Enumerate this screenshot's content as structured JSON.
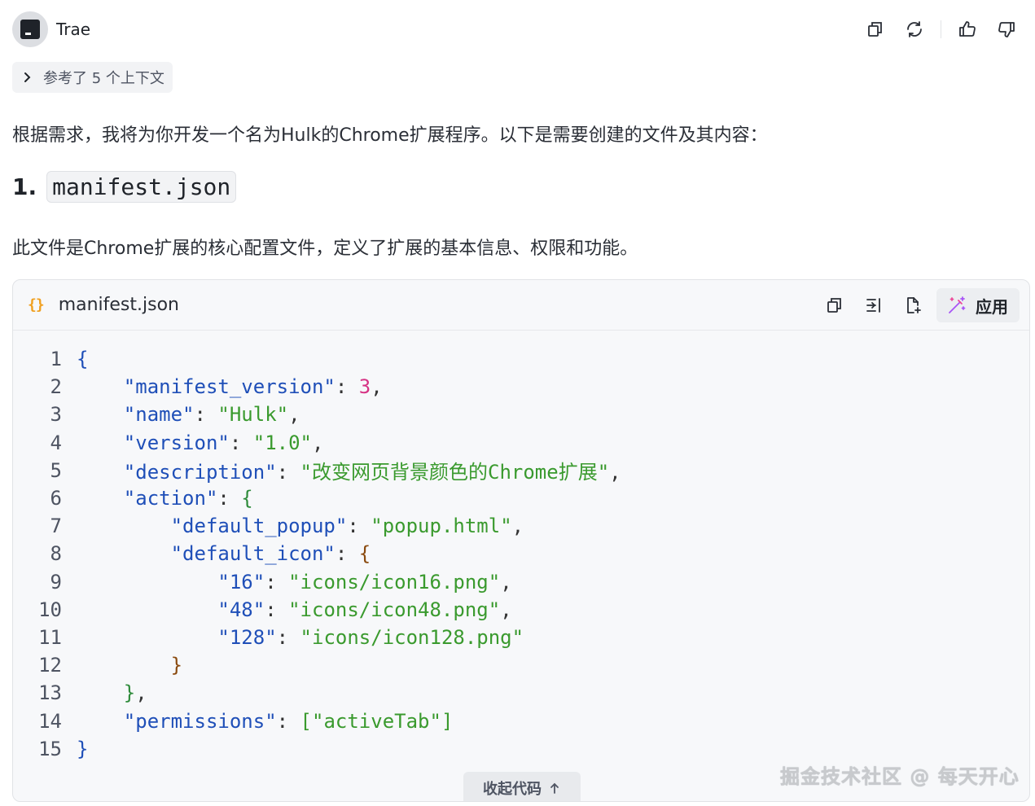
{
  "header": {
    "brand": "Trae",
    "actions": [
      "copy-icon",
      "refresh-icon",
      "thumb-up-icon",
      "thumb-down-icon"
    ]
  },
  "context": {
    "label": "参考了 5 个上下文"
  },
  "intro": "根据需求，我将为你开发一个名为Hulk的Chrome扩展程序。以下是需要创建的文件及其内容：",
  "section": {
    "number": "1.",
    "filename": "manifest.json"
  },
  "description": "此文件是Chrome扩展的核心配置文件，定义了扩展的基本信息、权限和功能。",
  "code_block": {
    "icon": "{}",
    "filename": "manifest.json",
    "apply_label": "应用",
    "collapse_label": "收起代码",
    "lines": [
      {
        "num": "1",
        "html": "<span class='b1'>{</span>"
      },
      {
        "num": "2",
        "html": "    <span class='k'>\"manifest_version\"</span><span class='p'>: </span><span class='n'>3</span><span class='p'>,</span>"
      },
      {
        "num": "3",
        "html": "    <span class='k'>\"name\"</span><span class='p'>: </span><span class='s'>\"Hulk\"</span><span class='p'>,</span>"
      },
      {
        "num": "4",
        "html": "    <span class='k'>\"version\"</span><span class='p'>: </span><span class='s'>\"1.0\"</span><span class='p'>,</span>"
      },
      {
        "num": "5",
        "html": "    <span class='k'>\"description\"</span><span class='p'>: </span><span class='s'>\"改变网页背景颜色的Chrome扩展\"</span><span class='p'>,</span>"
      },
      {
        "num": "6",
        "html": "    <span class='k'>\"action\"</span><span class='p'>: </span><span class='b2'>{</span>"
      },
      {
        "num": "7",
        "html": "        <span class='k'>\"default_popup\"</span><span class='p'>: </span><span class='s'>\"popup.html\"</span><span class='p'>,</span>"
      },
      {
        "num": "8",
        "html": "        <span class='k'>\"default_icon\"</span><span class='p'>: </span><span class='b3'>{</span>"
      },
      {
        "num": "9",
        "html": "            <span class='k'>\"16\"</span><span class='p'>: </span><span class='s'>\"icons/icon16.png\"</span><span class='p'>,</span>"
      },
      {
        "num": "10",
        "html": "            <span class='k'>\"48\"</span><span class='p'>: </span><span class='s'>\"icons/icon48.png\"</span><span class='p'>,</span>"
      },
      {
        "num": "11",
        "html": "            <span class='k'>\"128\"</span><span class='p'>: </span><span class='s'>\"icons/icon128.png\"</span>"
      },
      {
        "num": "12",
        "html": "        <span class='b3'>}</span>"
      },
      {
        "num": "13",
        "html": "    <span class='b2'>}</span><span class='p'>,</span>"
      },
      {
        "num": "14",
        "html": "    <span class='k'>\"permissions\"</span><span class='p'>: </span><span class='s'>[\"activeTab\"]</span>"
      },
      {
        "num": "15",
        "html": "<span class='b1'>}</span>"
      }
    ]
  },
  "watermark": "掘金技术社区 @ 每天开心"
}
